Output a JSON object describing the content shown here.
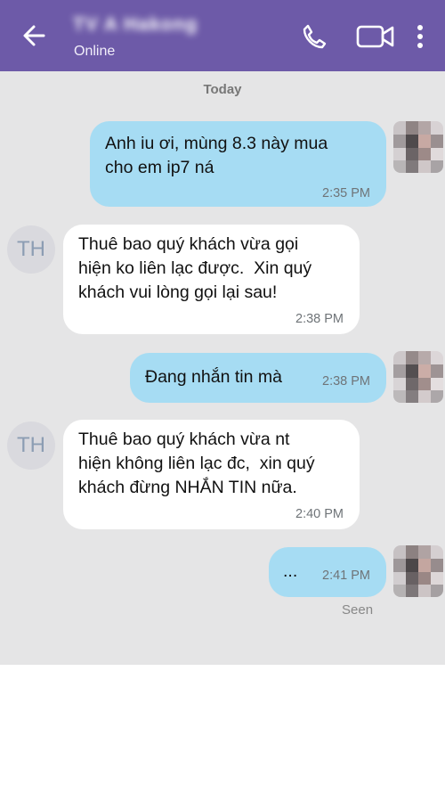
{
  "header": {
    "contact_name": "TV A Hakong",
    "status": "Online",
    "back_icon": "arrow-left-icon",
    "call_icon": "phone-icon",
    "video_icon": "video-camera-icon",
    "menu_icon": "more-vertical-icon"
  },
  "date_separator": "Today",
  "messages": [
    {
      "direction": "out",
      "text": "Anh iu ơi, mùng 8.3 này mua\ncho em ip7 ná",
      "time": "2:35 PM"
    },
    {
      "direction": "in",
      "avatar": "TH",
      "text": "Thuê bao quý khách vừa gọi\nhiện ko liên lạc được.  Xin quý\nkhách vui lòng gọi lại sau!",
      "time": "2:38 PM"
    },
    {
      "direction": "out",
      "text": "Đang nhắn tin mà",
      "time": "2:38 PM"
    },
    {
      "direction": "in",
      "avatar": "TH",
      "text": "Thuê bao quý khách vừa nt\nhiện không liên lạc đc,  xin quý\nkhách đừng NHẮN TIN nữa.",
      "time": "2:40 PM"
    },
    {
      "direction": "out",
      "text": "...",
      "time": "2:41 PM"
    }
  ],
  "seen_label": "Seen",
  "colors": {
    "header": "#6d5aa8",
    "chat_background": "#e5e5e6",
    "outgoing_bubble": "#a6dcf3",
    "incoming_bubble": "#ffffff"
  }
}
